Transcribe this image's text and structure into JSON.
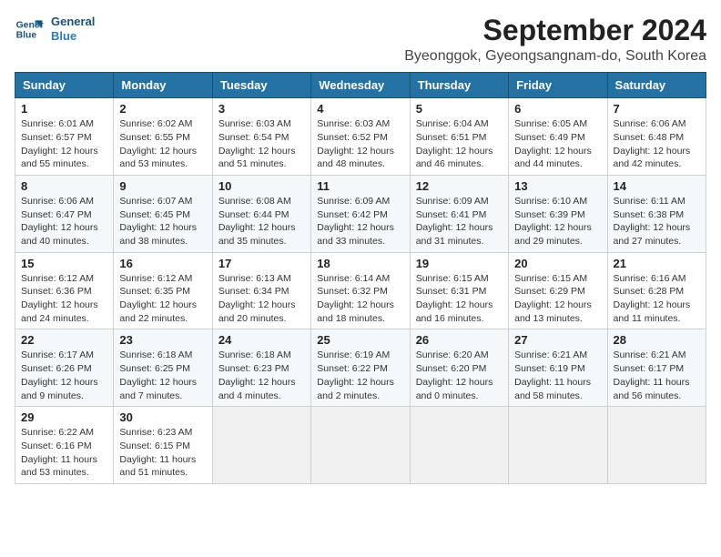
{
  "logo": {
    "line1": "General",
    "line2": "Blue"
  },
  "title": "September 2024",
  "location": "Byeonggok, Gyeongsangnam-do, South Korea",
  "weekdays": [
    "Sunday",
    "Monday",
    "Tuesday",
    "Wednesday",
    "Thursday",
    "Friday",
    "Saturday"
  ],
  "weeks": [
    [
      {
        "day": "1",
        "sunrise": "6:01 AM",
        "sunset": "6:57 PM",
        "daylight": "12 hours and 55 minutes."
      },
      {
        "day": "2",
        "sunrise": "6:02 AM",
        "sunset": "6:55 PM",
        "daylight": "12 hours and 53 minutes."
      },
      {
        "day": "3",
        "sunrise": "6:03 AM",
        "sunset": "6:54 PM",
        "daylight": "12 hours and 51 minutes."
      },
      {
        "day": "4",
        "sunrise": "6:03 AM",
        "sunset": "6:52 PM",
        "daylight": "12 hours and 48 minutes."
      },
      {
        "day": "5",
        "sunrise": "6:04 AM",
        "sunset": "6:51 PM",
        "daylight": "12 hours and 46 minutes."
      },
      {
        "day": "6",
        "sunrise": "6:05 AM",
        "sunset": "6:49 PM",
        "daylight": "12 hours and 44 minutes."
      },
      {
        "day": "7",
        "sunrise": "6:06 AM",
        "sunset": "6:48 PM",
        "daylight": "12 hours and 42 minutes."
      }
    ],
    [
      {
        "day": "8",
        "sunrise": "6:06 AM",
        "sunset": "6:47 PM",
        "daylight": "12 hours and 40 minutes."
      },
      {
        "day": "9",
        "sunrise": "6:07 AM",
        "sunset": "6:45 PM",
        "daylight": "12 hours and 38 minutes."
      },
      {
        "day": "10",
        "sunrise": "6:08 AM",
        "sunset": "6:44 PM",
        "daylight": "12 hours and 35 minutes."
      },
      {
        "day": "11",
        "sunrise": "6:09 AM",
        "sunset": "6:42 PM",
        "daylight": "12 hours and 33 minutes."
      },
      {
        "day": "12",
        "sunrise": "6:09 AM",
        "sunset": "6:41 PM",
        "daylight": "12 hours and 31 minutes."
      },
      {
        "day": "13",
        "sunrise": "6:10 AM",
        "sunset": "6:39 PM",
        "daylight": "12 hours and 29 minutes."
      },
      {
        "day": "14",
        "sunrise": "6:11 AM",
        "sunset": "6:38 PM",
        "daylight": "12 hours and 27 minutes."
      }
    ],
    [
      {
        "day": "15",
        "sunrise": "6:12 AM",
        "sunset": "6:36 PM",
        "daylight": "12 hours and 24 minutes."
      },
      {
        "day": "16",
        "sunrise": "6:12 AM",
        "sunset": "6:35 PM",
        "daylight": "12 hours and 22 minutes."
      },
      {
        "day": "17",
        "sunrise": "6:13 AM",
        "sunset": "6:34 PM",
        "daylight": "12 hours and 20 minutes."
      },
      {
        "day": "18",
        "sunrise": "6:14 AM",
        "sunset": "6:32 PM",
        "daylight": "12 hours and 18 minutes."
      },
      {
        "day": "19",
        "sunrise": "6:15 AM",
        "sunset": "6:31 PM",
        "daylight": "12 hours and 16 minutes."
      },
      {
        "day": "20",
        "sunrise": "6:15 AM",
        "sunset": "6:29 PM",
        "daylight": "12 hours and 13 minutes."
      },
      {
        "day": "21",
        "sunrise": "6:16 AM",
        "sunset": "6:28 PM",
        "daylight": "12 hours and 11 minutes."
      }
    ],
    [
      {
        "day": "22",
        "sunrise": "6:17 AM",
        "sunset": "6:26 PM",
        "daylight": "12 hours and 9 minutes."
      },
      {
        "day": "23",
        "sunrise": "6:18 AM",
        "sunset": "6:25 PM",
        "daylight": "12 hours and 7 minutes."
      },
      {
        "day": "24",
        "sunrise": "6:18 AM",
        "sunset": "6:23 PM",
        "daylight": "12 hours and 4 minutes."
      },
      {
        "day": "25",
        "sunrise": "6:19 AM",
        "sunset": "6:22 PM",
        "daylight": "12 hours and 2 minutes."
      },
      {
        "day": "26",
        "sunrise": "6:20 AM",
        "sunset": "6:20 PM",
        "daylight": "12 hours and 0 minutes."
      },
      {
        "day": "27",
        "sunrise": "6:21 AM",
        "sunset": "6:19 PM",
        "daylight": "11 hours and 58 minutes."
      },
      {
        "day": "28",
        "sunrise": "6:21 AM",
        "sunset": "6:17 PM",
        "daylight": "11 hours and 56 minutes."
      }
    ],
    [
      {
        "day": "29",
        "sunrise": "6:22 AM",
        "sunset": "6:16 PM",
        "daylight": "11 hours and 53 minutes."
      },
      {
        "day": "30",
        "sunrise": "6:23 AM",
        "sunset": "6:15 PM",
        "daylight": "11 hours and 51 minutes."
      },
      null,
      null,
      null,
      null,
      null
    ]
  ]
}
